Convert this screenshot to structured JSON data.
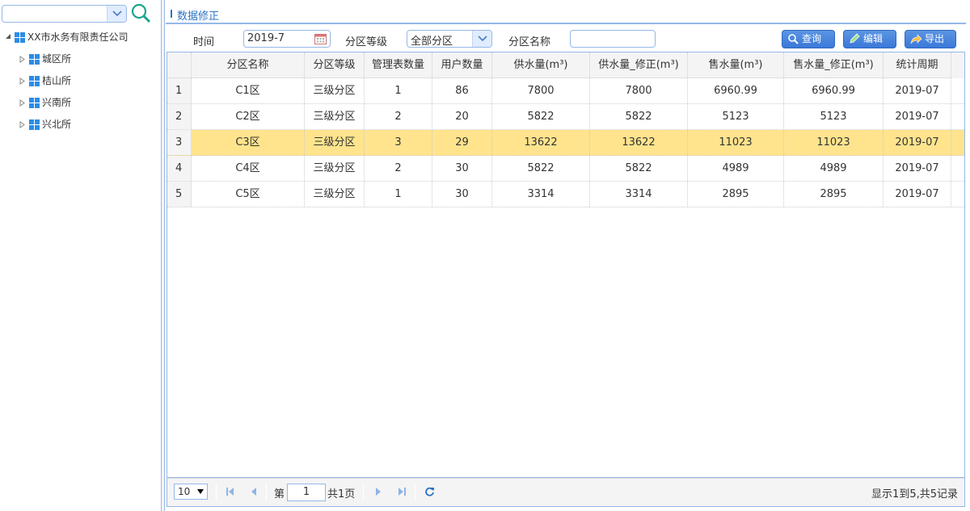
{
  "sidebar": {
    "combo_value": "",
    "tree_root": "XX市水务有限责任公司",
    "tree_items": [
      {
        "label": "城区所"
      },
      {
        "label": "桔山所"
      },
      {
        "label": "兴南所"
      },
      {
        "label": "兴北所"
      }
    ]
  },
  "panel": {
    "title": "数据修正"
  },
  "filters": {
    "time_label": "时间",
    "time_value": "2019-7",
    "level_label": "分区等级",
    "level_value": "全部分区",
    "name_label": "分区名称",
    "name_value": ""
  },
  "buttons": {
    "query": "查询",
    "edit": "编辑",
    "export": "导出"
  },
  "table": {
    "columns": [
      "分区名称",
      "分区等级",
      "管理表数量",
      "用户数量",
      "供水量(m³)",
      "供水量_修正(m³)",
      "售水量(m³)",
      "售水量_修正(m³)",
      "统计周期"
    ],
    "rows": [
      {
        "no": "1",
        "cells": [
          "C1区",
          "三级分区",
          "1",
          "86",
          "7800",
          "7800",
          "6960.99",
          "6960.99",
          "2019-07"
        ]
      },
      {
        "no": "2",
        "cells": [
          "C2区",
          "三级分区",
          "2",
          "20",
          "5822",
          "5822",
          "5123",
          "5123",
          "2019-07"
        ]
      },
      {
        "no": "3",
        "cells": [
          "C3区",
          "三级分区",
          "3",
          "29",
          "13622",
          "13622",
          "11023",
          "11023",
          "2019-07"
        ],
        "selected": true
      },
      {
        "no": "4",
        "cells": [
          "C4区",
          "三级分区",
          "2",
          "30",
          "5822",
          "5822",
          "4989",
          "4989",
          "2019-07"
        ]
      },
      {
        "no": "5",
        "cells": [
          "C5区",
          "三级分区",
          "1",
          "30",
          "3314",
          "3314",
          "2895",
          "2895",
          "2019-07"
        ]
      }
    ]
  },
  "pager": {
    "page_size": "10",
    "page_prefix": "第",
    "page_number": "1",
    "page_total": "共1页",
    "info": "显示1到5,共5记录"
  },
  "colors": {
    "accent": "#2b74c7",
    "border": "#95b8e7",
    "selected_row": "#ffe48d",
    "button": "#3b78d8"
  }
}
